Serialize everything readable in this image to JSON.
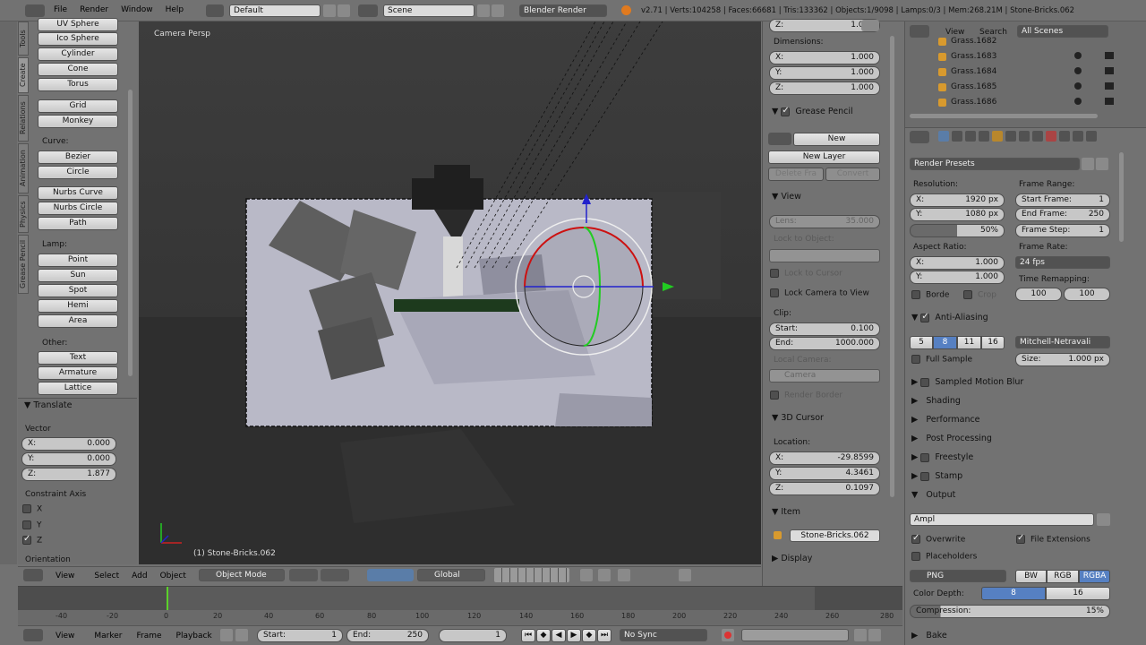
{
  "info_header": {
    "menus": [
      "File",
      "Render",
      "Window",
      "Help"
    ],
    "layout": "Default",
    "scene": "Scene",
    "engine": "Blender Render",
    "stats": "v2.71 | Verts:104258 | Faces:66681 | Tris:133362 | Objects:1/9098 | Lamps:0/3 | Mem:268.21M | Stone-Bricks.062"
  },
  "tool_tabs": [
    "Tools",
    "Create",
    "Relations",
    "Animation",
    "Physics",
    "Grease Pencil"
  ],
  "toolshelf": {
    "mesh_buttons": [
      "UV Sphere",
      "Ico Sphere",
      "Cylinder",
      "Cone",
      "Torus"
    ],
    "more_mesh": [
      "Grid",
      "Monkey"
    ],
    "curve_label": "Curve:",
    "curve_buttons": [
      "Bezier",
      "Circle"
    ],
    "nurbs_buttons": [
      "Nurbs Curve",
      "Nurbs Circle",
      "Path"
    ],
    "lamp_label": "Lamp:",
    "lamp_buttons": [
      "Point",
      "Sun",
      "Spot",
      "Hemi",
      "Area"
    ],
    "other_label": "Other:",
    "other_buttons": [
      "Text",
      "Armature",
      "Lattice"
    ]
  },
  "operator": {
    "title": "Translate",
    "vector_label": "Vector",
    "x": {
      "k": "X:",
      "v": "0.000"
    },
    "y": {
      "k": "Y:",
      "v": "0.000"
    },
    "z": {
      "k": "Z:",
      "v": "1.877"
    },
    "constraint_label": "Constraint Axis",
    "axes": [
      "X",
      "Y",
      "Z"
    ],
    "orientation_label": "Orientation"
  },
  "viewport": {
    "label": "Camera Persp",
    "object_label": "(1) Stone-Bricks.062"
  },
  "view3d_header": {
    "view": "View",
    "select": "Select",
    "add": "Add",
    "object": "Object",
    "mode": "Object Mode",
    "orientation": "Global"
  },
  "properties_n": {
    "z_top": {
      "k": "Z:",
      "v": "1.000"
    },
    "dimensions_label": "Dimensions:",
    "dims": [
      {
        "k": "X:",
        "v": "1.000"
      },
      {
        "k": "Y:",
        "v": "1.000"
      },
      {
        "k": "Z:",
        "v": "1.000"
      }
    ],
    "grease_pencil": "Grease Pencil",
    "new": "New",
    "new_layer": "New Layer",
    "delete_frame": "Delete Fra",
    "convert": "Convert",
    "view": "View",
    "lens": {
      "k": "Lens:",
      "v": "35.000"
    },
    "lock_to_object": "Lock to Object:",
    "lock_to_cursor": "Lock to Cursor",
    "lock_camera": "Lock Camera to View",
    "clip": "Clip:",
    "start": {
      "k": "Start:",
      "v": "0.100"
    },
    "end": {
      "k": "End:",
      "v": "1000.000"
    },
    "local_camera": "Local Camera:",
    "camera": "Camera",
    "render_border": "Render Border",
    "cursor_3d": "3D Cursor",
    "location": "Location:",
    "loc": [
      {
        "k": "X:",
        "v": "-29.8599"
      },
      {
        "k": "Y:",
        "v": "4.3461"
      },
      {
        "k": "Z:",
        "v": "0.1097"
      }
    ],
    "item": "Item",
    "item_name": "Stone-Bricks.062",
    "display": "Display"
  },
  "outliner": {
    "view": "View",
    "search": "Search",
    "scope": "All Scenes",
    "items": [
      "Grass.1682",
      "Grass.1683",
      "Grass.1684",
      "Grass.1685",
      "Grass.1686"
    ]
  },
  "render": {
    "presets": "Render Presets",
    "resolution": "Resolution:",
    "res_x": {
      "k": "X:",
      "v": "1920 px"
    },
    "res_y": {
      "k": "Y:",
      "v": "1080 px"
    },
    "res_pct": "50%",
    "frame_range": "Frame Range:",
    "start_frame": {
      "k": "Start Frame:",
      "v": "1"
    },
    "end_frame": {
      "k": "End Frame:",
      "v": "250"
    },
    "frame_step": {
      "k": "Frame Step:",
      "v": "1"
    },
    "aspect": "Aspect Ratio:",
    "asp_x": {
      "k": "X:",
      "v": "1.000"
    },
    "asp_y": {
      "k": "Y:",
      "v": "1.000"
    },
    "frame_rate": "Frame Rate:",
    "fps": "24 fps",
    "time_remap": "Time Remapping:",
    "remap_old": "100",
    "remap_new": "100",
    "border": "Borde",
    "crop": "Crop",
    "aa": "Anti-Aliasing",
    "aa_samples": [
      "5",
      "8",
      "11",
      "16"
    ],
    "aa_filter": "Mitchell-Netravali",
    "full_sample": "Full Sample",
    "size": {
      "k": "Size:",
      "v": "1.000 px"
    },
    "sections": [
      "Sampled Motion Blur",
      "Shading",
      "Performance",
      "Post Processing",
      "Freestyle",
      "Stamp"
    ],
    "output": "Output",
    "path": "Ampl",
    "overwrite": "Overwrite",
    "file_ext": "File Extensions",
    "placeholders": "Placeholders",
    "format": "PNG",
    "bw": "BW",
    "rgb": "RGB",
    "rgba": "RGBA",
    "color_depth": "Color Depth:",
    "depth_8": "8",
    "depth_16": "16",
    "compression": "Compression:",
    "compression_val": "15%",
    "bake": "Bake"
  },
  "timeline": {
    "ticks": [
      "-40",
      "-20",
      "0",
      "20",
      "40",
      "60",
      "80",
      "100",
      "120",
      "140",
      "160",
      "180",
      "200",
      "220",
      "240",
      "260",
      "280"
    ],
    "view": "View",
    "marker": "Marker",
    "frame": "Frame",
    "playback": "Playback",
    "start": {
      "k": "Start:",
      "v": "1"
    },
    "end": {
      "k": "End:",
      "v": "250"
    },
    "current": "1",
    "sync": "No Sync"
  }
}
